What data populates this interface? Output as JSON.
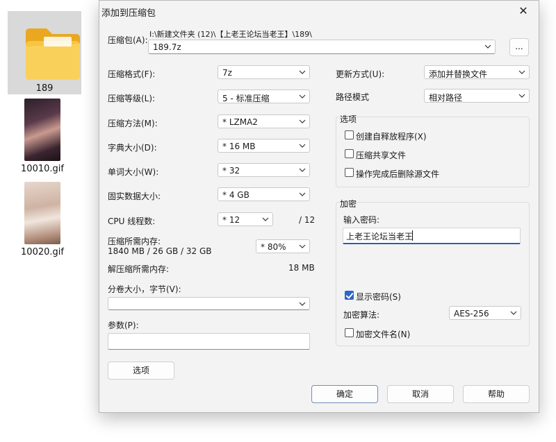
{
  "desktop": {
    "files": [
      {
        "name": "189",
        "icon": "folder-icon"
      },
      {
        "name": "10010.gif",
        "icon": "image-thumbnail"
      },
      {
        "name": "10020.gif",
        "icon": "image-thumbnail"
      }
    ]
  },
  "dialog": {
    "title": "添加到压缩包",
    "close_glyph": "✕",
    "archive": {
      "label": "压缩包(A):",
      "path": "I:\\新建文件夹 (12)\\【上老王论坛当老王】\\189\\",
      "name": "189.7z",
      "browse_label": "..."
    },
    "left": {
      "format": {
        "label": "压缩格式(F):",
        "value": "7z"
      },
      "level": {
        "label": "压缩等级(L):",
        "value": "5 - 标准压缩"
      },
      "method": {
        "label": "压缩方法(M):",
        "value": "* LZMA2"
      },
      "dict": {
        "label": "字典大小(D):",
        "value": "* 16 MB"
      },
      "word": {
        "label": "单词大小(W):",
        "value": "* 32"
      },
      "solid": {
        "label": "固实数据大小:",
        "value": "* 4 GB"
      },
      "threads": {
        "label": "CPU 线程数:",
        "value": "* 12",
        "max": "/ 12"
      },
      "mem_compress": {
        "label": "压缩所需内存:",
        "detail": "1840 MB / 26 GB / 32 GB",
        "value": "* 80%"
      },
      "mem_decompress": {
        "label": "解压缩所需内存:",
        "value": "18 MB"
      },
      "volume": {
        "label": "分卷大小，字节(V):",
        "value": ""
      },
      "params": {
        "label": "参数(P):",
        "value": ""
      },
      "options_button": "选项"
    },
    "right": {
      "update": {
        "label": "更新方式(U):",
        "value": "添加并替换文件"
      },
      "pathmode": {
        "label": "路径模式",
        "value": "相对路径"
      },
      "options_group": {
        "title": "选项",
        "items": [
          {
            "label": "创建自释放程序(X)",
            "checked": false
          },
          {
            "label": "压缩共享文件",
            "checked": false
          },
          {
            "label": "操作完成后删除源文件",
            "checked": false
          }
        ]
      },
      "encryption": {
        "title": "加密",
        "password_label": "输入密码:",
        "password_value": "上老王论坛当老王",
        "show_password": {
          "label": "显示密码(S)",
          "checked": true
        },
        "method_label": "加密算法:",
        "method_value": "AES-256",
        "encrypt_names": {
          "label": "加密文件名(N)",
          "checked": false
        }
      }
    },
    "buttons": {
      "ok": "确定",
      "cancel": "取消",
      "help": "帮助"
    },
    "colors": {
      "accent": "#2c66c8",
      "focus_underline": "#2b5fb3"
    }
  }
}
